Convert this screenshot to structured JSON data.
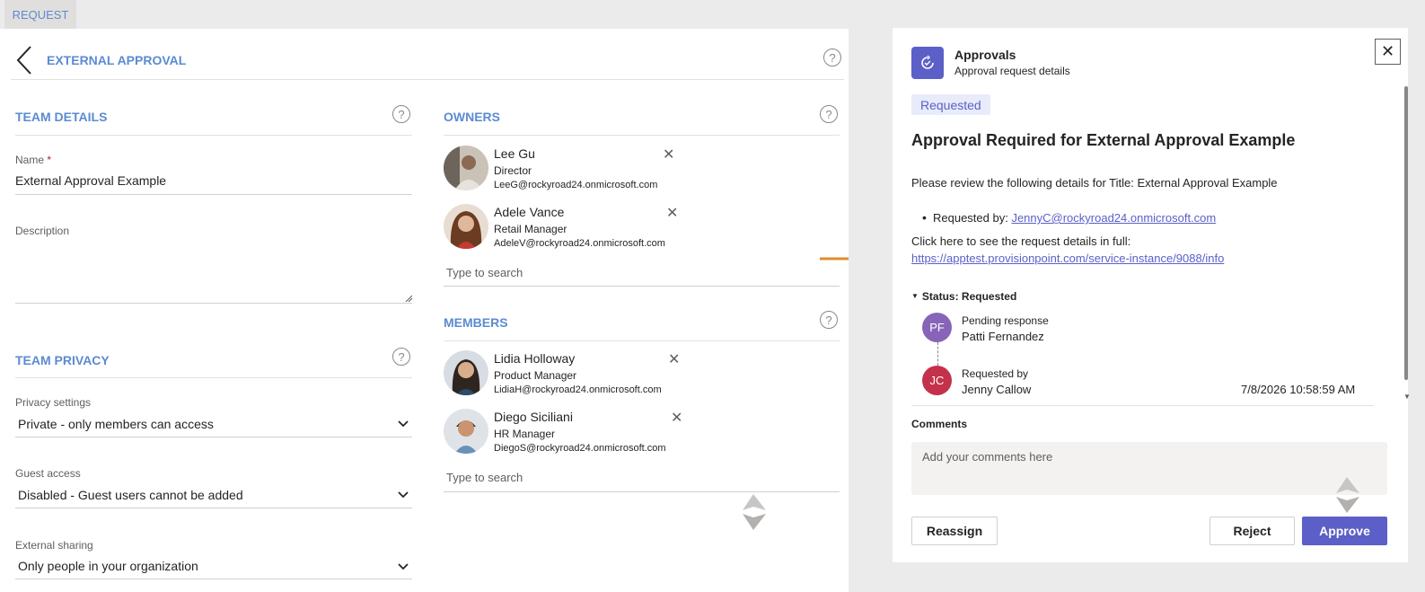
{
  "tab": {
    "label": "REQUEST"
  },
  "header": {
    "title": "EXTERNAL APPROVAL"
  },
  "team_details": {
    "title": "TEAM DETAILS",
    "name_label": "Name",
    "required_mark": "*",
    "name_value": "External Approval Example",
    "description_label": "Description"
  },
  "team_privacy": {
    "title": "TEAM PRIVACY",
    "privacy_label": "Privacy settings",
    "privacy_value": "Private - only members can access",
    "guest_label": "Guest access",
    "guest_value": "Disabled - Guest users cannot be added",
    "external_label": "External sharing",
    "external_value": "Only people in your organization"
  },
  "owners": {
    "title": "OWNERS",
    "people": [
      {
        "name": "Lee Gu",
        "role": "Director",
        "email": "LeeG@rockyroad24.onmicrosoft.com"
      },
      {
        "name": "Adele Vance",
        "role": "Retail Manager",
        "email": "AdeleV@rockyroad24.onmicrosoft.com"
      }
    ],
    "search_placeholder": "Type to search"
  },
  "members": {
    "title": "MEMBERS",
    "people": [
      {
        "name": "Lidia Holloway",
        "role": "Product Manager",
        "email": "LidiaH@rockyroad24.onmicrosoft.com"
      },
      {
        "name": "Diego Siciliani",
        "role": "HR Manager",
        "email": "DiegoS@rockyroad24.onmicrosoft.com"
      }
    ],
    "search_placeholder": "Type to search"
  },
  "approvals": {
    "app_name": "Approvals",
    "app_subtitle": "Approval request details",
    "status_badge": "Requested",
    "title": "Approval Required for External Approval Example",
    "review_text": "Please review the following details for Title: External Approval Example",
    "requested_by_label": "Requested by: ",
    "requested_by_email": "JennyC@rockyroad24.onmicrosoft.com",
    "details_text": "Click here to see the request details in full:",
    "details_link": "https://apptest.provisionpoint.com/service-instance/9088/info",
    "status_heading": "Status: Requested",
    "steps": [
      {
        "initials": "PF",
        "label": "Pending response",
        "name": "Patti Fernandez",
        "date": "",
        "color": "#8764b8"
      },
      {
        "initials": "JC",
        "label": "Requested by",
        "name": "Jenny Callow",
        "date": "7/8/2026 10:58:59 AM",
        "color": "#c4314b"
      }
    ],
    "comments_label": "Comments",
    "comments_placeholder": "Add your comments here",
    "buttons": {
      "reassign": "Reassign",
      "reject": "Reject",
      "approve": "Approve"
    }
  },
  "colors": {
    "accent": "#5b5fc7",
    "section_blue": "#5b8bd1",
    "arrow": "#e08c2d"
  },
  "icons": [
    "back-chevron-icon",
    "help-icon",
    "remove-icon",
    "chevron-down-icon",
    "approvals-app-icon",
    "close-icon",
    "watermark-logo-icon"
  ]
}
